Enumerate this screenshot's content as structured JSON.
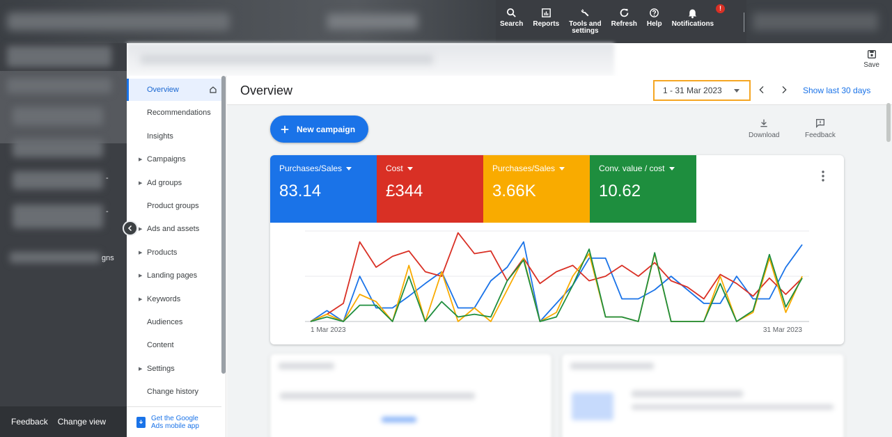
{
  "toolbar": {
    "search": "Search",
    "reports": "Reports",
    "tools_line1": "Tools and",
    "tools_line2": "settings",
    "refresh": "Refresh",
    "help": "Help",
    "notifications": "Notifications",
    "notification_badge": "!"
  },
  "save_label": "Save",
  "sidebar_footer": {
    "feedback": "Feedback",
    "change_view": "Change view"
  },
  "sidebar_fragment": "gns",
  "page_menu": {
    "items": [
      {
        "label": "Overview",
        "active": true
      },
      {
        "label": "Recommendations"
      },
      {
        "label": "Insights"
      },
      {
        "label": "Campaigns",
        "expandable": true
      },
      {
        "label": "Ad groups",
        "expandable": true
      },
      {
        "label": "Product groups"
      },
      {
        "label": "Ads and assets",
        "expandable": true
      },
      {
        "label": "Products",
        "expandable": true
      },
      {
        "label": "Landing pages",
        "expandable": true
      },
      {
        "label": "Keywords",
        "expandable": true
      },
      {
        "label": "Audiences"
      },
      {
        "label": "Content"
      },
      {
        "label": "Settings",
        "expandable": true
      },
      {
        "label": "Change history"
      }
    ],
    "mobile_app_line1": "Get the Google",
    "mobile_app_line2": "Ads mobile app"
  },
  "header": {
    "title": "Overview",
    "date_range": "1 - 31 Mar 2023",
    "show_last": "Show last 30 days"
  },
  "actions": {
    "new_campaign": "New campaign",
    "download": "Download",
    "feedback": "Feedback"
  },
  "metrics": [
    {
      "name": "Purchases/Sales",
      "value": "83.14",
      "color": "#1a73e8"
    },
    {
      "name": "Cost",
      "value": "£344",
      "color": "#d93025"
    },
    {
      "name": "Purchases/Sales",
      "value": "3.66K",
      "color": "#f9ab00"
    },
    {
      "name": "Conv. value / cost",
      "value": "10.62",
      "color": "#1e8e3e"
    }
  ],
  "chart_data": {
    "type": "line",
    "x_start_label": "1 Mar 2023",
    "x_end_label": "31 Mar 2023",
    "x": [
      1,
      2,
      3,
      4,
      5,
      6,
      7,
      8,
      9,
      10,
      11,
      12,
      13,
      14,
      15,
      16,
      17,
      18,
      19,
      20,
      21,
      22,
      23,
      24,
      25,
      26,
      27,
      28,
      29,
      30,
      31
    ],
    "ylim": [
      0,
      100
    ],
    "grid": true,
    "series": [
      {
        "color": "#1a73e8",
        "values": [
          0,
          12,
          0,
          50,
          15,
          15,
          28,
          42,
          55,
          15,
          15,
          45,
          60,
          88,
          0,
          20,
          40,
          70,
          70,
          25,
          25,
          35,
          50,
          35,
          20,
          20,
          50,
          25,
          25,
          60,
          85
        ]
      },
      {
        "color": "#d93025",
        "values": [
          0,
          8,
          20,
          88,
          60,
          72,
          78,
          55,
          50,
          98,
          75,
          78,
          45,
          70,
          42,
          55,
          62,
          45,
          50,
          62,
          50,
          65,
          45,
          38,
          25,
          52,
          42,
          28,
          48,
          30,
          48
        ]
      },
      {
        "color": "#f9ab00",
        "values": [
          0,
          8,
          0,
          30,
          22,
          0,
          62,
          0,
          55,
          0,
          15,
          0,
          35,
          70,
          0,
          10,
          50,
          75,
          5,
          5,
          0,
          75,
          0,
          0,
          0,
          50,
          0,
          10,
          70,
          10,
          50
        ]
      },
      {
        "color": "#1e8e3e",
        "values": [
          0,
          5,
          0,
          18,
          18,
          0,
          50,
          0,
          22,
          5,
          8,
          5,
          45,
          68,
          0,
          5,
          40,
          80,
          5,
          5,
          0,
          76,
          0,
          0,
          0,
          42,
          0,
          12,
          74,
          16,
          48
        ]
      }
    ]
  }
}
